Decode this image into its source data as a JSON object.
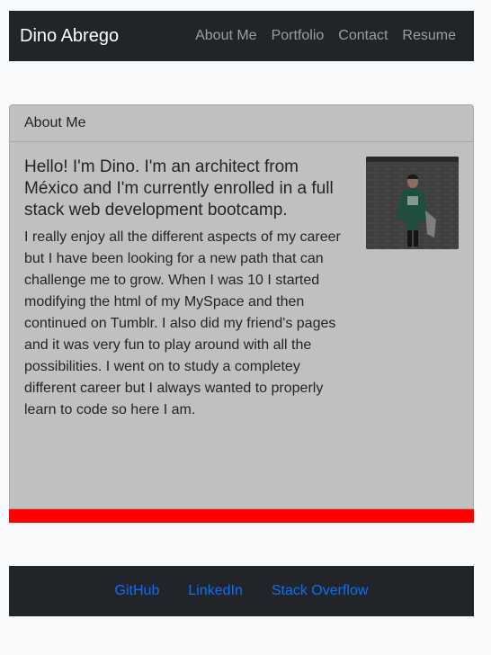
{
  "navbar": {
    "brand": "Dino Abrego",
    "links": [
      "About Me",
      "Portfolio",
      "Contact",
      "Resume"
    ]
  },
  "card": {
    "header": "About Me",
    "lead": "Hello! I'm Dino. I'm an architect from México and I'm currently enrolled in a full stack web development bootcamp.",
    "bio": "I really enjoy all the different aspects of my career but I have been looking for a new path that can challenge me to grow. When I was 10 I started modifying the html of my MySpace and then continued on Tumblr. I also did my friend's pages and it was very fun to play around with all the possibilities. I went on to study a completey different career but I always wanted to properly learn to code so here I am."
  },
  "footer": {
    "links": [
      "GitHub",
      "LinkedIn",
      "Stack Overflow"
    ]
  },
  "colors": {
    "navbar_bg": "#212529",
    "card_bg": "#c0c0c0",
    "accent_bar": "#ff0000",
    "footer_link": "#0d6efd"
  }
}
